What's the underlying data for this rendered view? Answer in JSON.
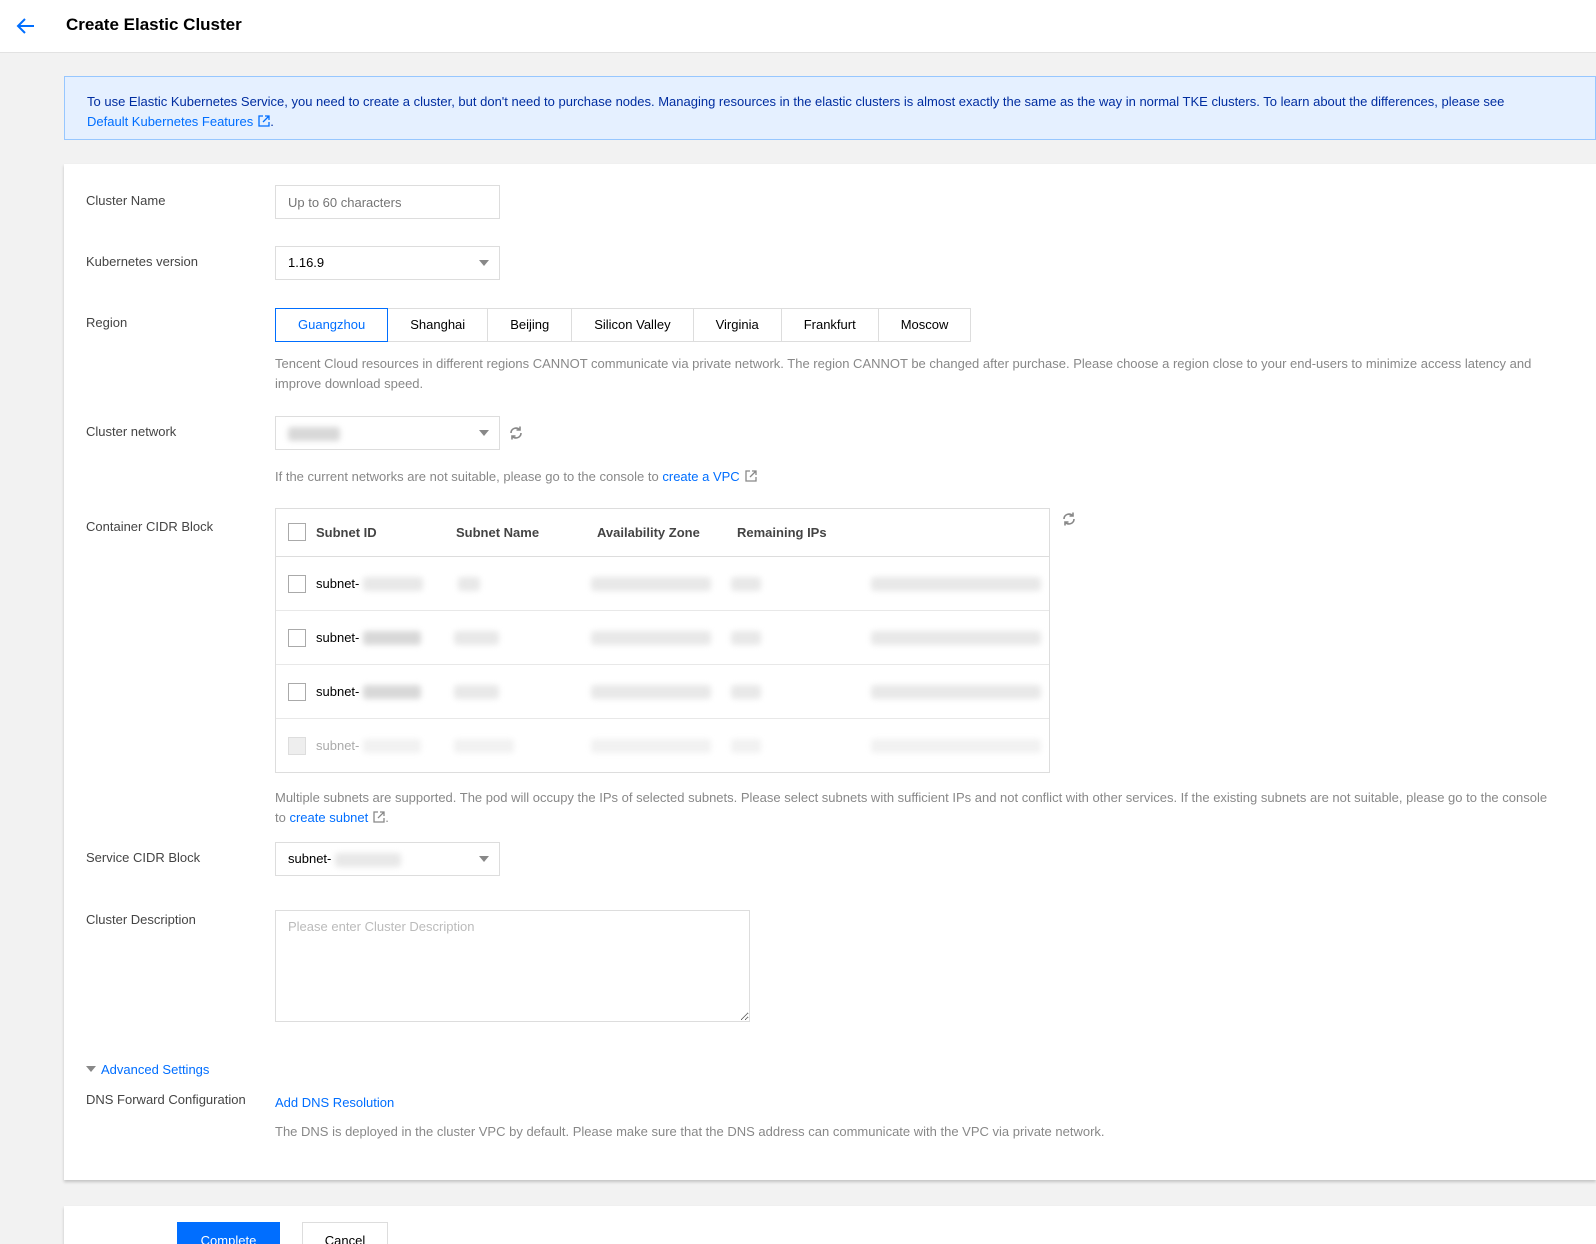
{
  "header": {
    "title": "Create Elastic Cluster",
    "back_icon": "arrow-left-icon"
  },
  "notice": {
    "text": "To use Elastic Kubernetes Service, you need to create a cluster, but don't need to purchase nodes. Managing resources in the elastic clusters is almost exactly the same as the way in normal TKE clusters. To learn about the differences, please see",
    "link": "Default Kubernetes Features",
    "suffix": "."
  },
  "form": {
    "cluster_name": {
      "label": "Cluster Name",
      "placeholder": "Up to 60 characters"
    },
    "k8s_version": {
      "label": "Kubernetes version",
      "value": "1.16.9"
    },
    "region": {
      "label": "Region",
      "options": [
        "Guangzhou",
        "Shanghai",
        "Beijing",
        "Silicon Valley",
        "Virginia",
        "Frankfurt",
        "Moscow"
      ],
      "selected": "Guangzhou",
      "help": "Tencent Cloud resources in different regions CANNOT communicate via private network. The region CANNOT be changed after purchase. Please choose a region close to your end-users to minimize access latency and improve download speed."
    },
    "cluster_network": {
      "label": "Cluster network",
      "help_prefix": "If the current networks are not suitable, please go to the console to",
      "help_link": "create a VPC"
    },
    "container_cidr": {
      "label": "Container CIDR Block",
      "columns": [
        "Subnet ID",
        "Subnet Name",
        "Availability Zone",
        "Remaining IPs"
      ],
      "rows": [
        {
          "subnet_id": "subnet-",
          "disabled": false
        },
        {
          "subnet_id": "subnet-",
          "disabled": false
        },
        {
          "subnet_id": "subnet-",
          "disabled": false
        },
        {
          "subnet_id": "subnet-",
          "disabled": true
        }
      ],
      "help_prefix": "Multiple subnets are supported. The pod will occupy the IPs of selected subnets. Please select subnets with sufficient IPs and not conflict with other services. If the existing subnets are not suitable, please go to the console to",
      "help_link": "create subnet",
      "help_suffix": "."
    },
    "service_cidr": {
      "label": "Service CIDR Block",
      "value": "subnet-"
    },
    "description": {
      "label": "Cluster Description",
      "placeholder": "Please enter Cluster Description"
    },
    "advanced": {
      "toggle": "Advanced Settings",
      "dns_label": "DNS Forward Configuration",
      "dns_link": "Add DNS Resolution",
      "dns_help": "The DNS is deployed in the cluster VPC by default. Please make sure that the DNS address can communicate with the VPC via private network."
    }
  },
  "footer": {
    "complete": "Complete",
    "cancel": "Cancel"
  },
  "colors": {
    "accent": "#006eff",
    "notice_bg": "#e5f0ff"
  }
}
